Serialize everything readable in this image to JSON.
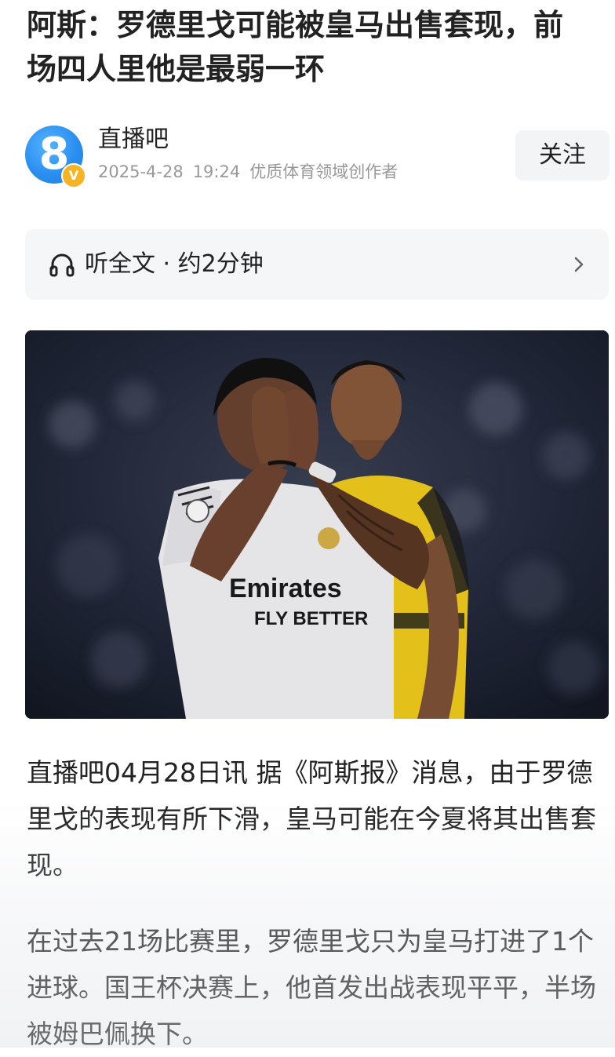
{
  "article": {
    "title": "阿斯：罗德里戈可能被皇马出售套现，前场四人里他是最弱一环"
  },
  "author": {
    "avatar_glyph": "8",
    "verified_glyph": "V",
    "name": "直播吧",
    "date": "2025-4-28",
    "time": "19:24",
    "tag": "优质体育领域创作者",
    "follow_label": "关注"
  },
  "listen": {
    "label": "听全文 · 约2分钟",
    "icon": "headphone-icon",
    "chevron_icon": "chevron-right-icon"
  },
  "photo": {
    "jersey_sponsor_line1": "Emirates",
    "jersey_sponsor_line2": "FLY BETTER"
  },
  "body": {
    "paragraph_1": "直播吧04月28日讯 据《阿斯报》消息，由于罗德里戈的表现有所下滑，皇马可能在今夏将其出售套现。",
    "paragraph_2": "在过去21场比赛里，罗德里戈只为皇马打进了1个进球。国王杯决赛上，他首发出战表现平平，半场被姆巴佩换下。"
  },
  "colors": {
    "text": "#222222",
    "meta": "#999999",
    "avatar_blue": "#2a8ff0",
    "verified_gold": "#f6b425",
    "button_bg": "#f3f4f6"
  }
}
